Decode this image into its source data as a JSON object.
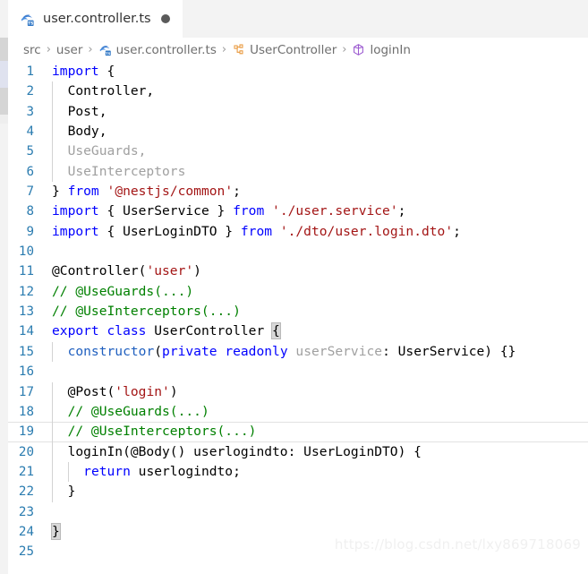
{
  "window": {
    "app": "Visual Studio Code",
    "theme_background": "#ffffff",
    "tabbar_background": "#f3f3f3"
  },
  "tab": {
    "label": "user.controller.ts",
    "icon": "typescript-nest-file-icon",
    "dirty_indicator": "unsaved-dot",
    "active": true
  },
  "breadcrumbs": {
    "separator": "›",
    "items": [
      {
        "label": "src",
        "icon": null
      },
      {
        "label": "user",
        "icon": null
      },
      {
        "label": "user.controller.ts",
        "icon": "typescript-nest-file-icon"
      },
      {
        "label": "UserController",
        "icon": "symbol-class-icon"
      },
      {
        "label": "loginIn",
        "icon": "symbol-method-icon"
      }
    ]
  },
  "editor": {
    "language": "typescript",
    "current_line": 19,
    "first_line": 1,
    "last_line": 25,
    "colors": {
      "keyword": "#0000ff",
      "string": "#a31515",
      "comment": "#008000",
      "unused": "#a0a0a0",
      "function": "#1f5fbf",
      "line_number": "#2b7cb0",
      "bracket_match": "#d8d8d8"
    },
    "lines": [
      {
        "n": 1,
        "indent": 0,
        "tokens": [
          {
            "t": "import",
            "c": "key"
          },
          {
            "t": " ",
            "c": "plain"
          },
          {
            "t": "{",
            "c": "punc"
          }
        ]
      },
      {
        "n": 2,
        "indent": 1,
        "tokens": [
          {
            "t": "  Controller,",
            "c": "plain"
          }
        ]
      },
      {
        "n": 3,
        "indent": 1,
        "tokens": [
          {
            "t": "  Post,",
            "c": "plain"
          }
        ]
      },
      {
        "n": 4,
        "indent": 1,
        "tokens": [
          {
            "t": "  Body,",
            "c": "plain"
          }
        ]
      },
      {
        "n": 5,
        "indent": 1,
        "tokens": [
          {
            "t": "  UseGuards,",
            "c": "dim"
          }
        ]
      },
      {
        "n": 6,
        "indent": 1,
        "tokens": [
          {
            "t": "  UseInterceptors",
            "c": "dim"
          }
        ]
      },
      {
        "n": 7,
        "indent": 0,
        "tokens": [
          {
            "t": "} ",
            "c": "punc"
          },
          {
            "t": "from",
            "c": "key"
          },
          {
            "t": " ",
            "c": "plain"
          },
          {
            "t": "'@nestjs/common'",
            "c": "str"
          },
          {
            "t": ";",
            "c": "punc"
          }
        ]
      },
      {
        "n": 8,
        "indent": 0,
        "tokens": [
          {
            "t": "import",
            "c": "key"
          },
          {
            "t": " { UserService } ",
            "c": "plain"
          },
          {
            "t": "from",
            "c": "key"
          },
          {
            "t": " ",
            "c": "plain"
          },
          {
            "t": "'./user.service'",
            "c": "str"
          },
          {
            "t": ";",
            "c": "punc"
          }
        ]
      },
      {
        "n": 9,
        "indent": 0,
        "tokens": [
          {
            "t": "import",
            "c": "key"
          },
          {
            "t": " { UserLoginDTO } ",
            "c": "plain"
          },
          {
            "t": "from",
            "c": "key"
          },
          {
            "t": " ",
            "c": "plain"
          },
          {
            "t": "'./dto/user.login.dto'",
            "c": "str"
          },
          {
            "t": ";",
            "c": "punc"
          }
        ]
      },
      {
        "n": 10,
        "indent": 0,
        "tokens": []
      },
      {
        "n": 11,
        "indent": 0,
        "tokens": [
          {
            "t": "@Controller(",
            "c": "plain"
          },
          {
            "t": "'user'",
            "c": "str"
          },
          {
            "t": ")",
            "c": "plain"
          }
        ]
      },
      {
        "n": 12,
        "indent": 0,
        "tokens": [
          {
            "t": "// @UseGuards(...)",
            "c": "com"
          }
        ]
      },
      {
        "n": 13,
        "indent": 0,
        "tokens": [
          {
            "t": "// @UseInterceptors(...)",
            "c": "com"
          }
        ]
      },
      {
        "n": 14,
        "indent": 0,
        "tokens": [
          {
            "t": "export",
            "c": "key"
          },
          {
            "t": " ",
            "c": "plain"
          },
          {
            "t": "class",
            "c": "key"
          },
          {
            "t": " UserController ",
            "c": "plain"
          },
          {
            "t": "{",
            "c": "bracket"
          }
        ]
      },
      {
        "n": 15,
        "indent": 1,
        "tokens": [
          {
            "t": "  ",
            "c": "plain"
          },
          {
            "t": "constructor",
            "c": "fn"
          },
          {
            "t": "(",
            "c": "plain"
          },
          {
            "t": "private readonly",
            "c": "key"
          },
          {
            "t": " ",
            "c": "plain"
          },
          {
            "t": "userService",
            "c": "dim"
          },
          {
            "t": ": UserService) {}",
            "c": "plain"
          }
        ]
      },
      {
        "n": 16,
        "indent": 1,
        "tokens": []
      },
      {
        "n": 17,
        "indent": 1,
        "tokens": [
          {
            "t": "  @Post(",
            "c": "plain"
          },
          {
            "t": "'login'",
            "c": "str"
          },
          {
            "t": ")",
            "c": "plain"
          }
        ]
      },
      {
        "n": 18,
        "indent": 1,
        "tokens": [
          {
            "t": "  ",
            "c": "plain"
          },
          {
            "t": "// @UseGuards(...)",
            "c": "com"
          }
        ]
      },
      {
        "n": 19,
        "indent": 1,
        "tokens": [
          {
            "t": "  ",
            "c": "plain"
          },
          {
            "t": "// @UseInterceptors(...)",
            "c": "com"
          }
        ]
      },
      {
        "n": 20,
        "indent": 1,
        "tokens": [
          {
            "t": "  loginIn(@Body() userlogindto: UserLoginDTO) {",
            "c": "plain"
          }
        ]
      },
      {
        "n": 21,
        "indent": 2,
        "tokens": [
          {
            "t": "    ",
            "c": "plain"
          },
          {
            "t": "return",
            "c": "key"
          },
          {
            "t": " userlogindto;",
            "c": "plain"
          }
        ]
      },
      {
        "n": 22,
        "indent": 1,
        "tokens": [
          {
            "t": "  }",
            "c": "plain"
          }
        ]
      },
      {
        "n": 23,
        "indent": 1,
        "tokens": []
      },
      {
        "n": 24,
        "indent": 0,
        "tokens": [
          {
            "t": "}",
            "c": "bracket"
          }
        ]
      },
      {
        "n": 25,
        "indent": 0,
        "tokens": []
      }
    ]
  },
  "watermark": {
    "text": "https://blog.csdn.net/lxy869718069"
  }
}
